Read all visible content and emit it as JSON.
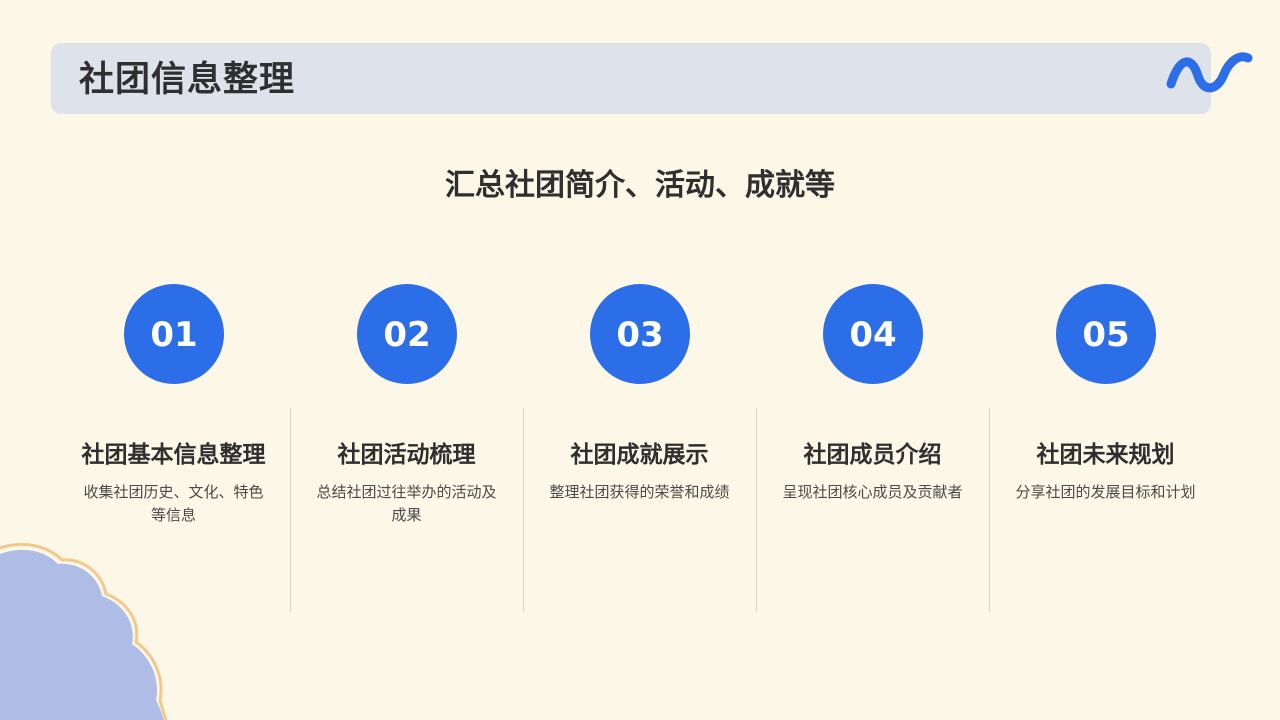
{
  "header": {
    "title": "社团信息整理",
    "decoration_icon": "wave-icon"
  },
  "subtitle": "汇总社团简介、活动、成就等",
  "items": [
    {
      "number": "01",
      "title": "社团基本信息整理",
      "desc": "收集社团历史、文化、特色等信息"
    },
    {
      "number": "02",
      "title": "社团活动梳理",
      "desc": "总结社团过往举办的活动及成果"
    },
    {
      "number": "03",
      "title": "社团成就展示",
      "desc": "整理社团获得的荣誉和成绩"
    },
    {
      "number": "04",
      "title": "社团成员介绍",
      "desc": "呈现社团核心成员及贡献者"
    },
    {
      "number": "05",
      "title": "社团未来规划",
      "desc": "分享社团的发展目标和计划"
    }
  ],
  "colors": {
    "background": "#FDF7E8",
    "header_bar": "#DEE2EA",
    "accent_blue": "#2C6EE8",
    "cloud": "#AFBCE6",
    "cloud_outline": "#F2C98B"
  }
}
